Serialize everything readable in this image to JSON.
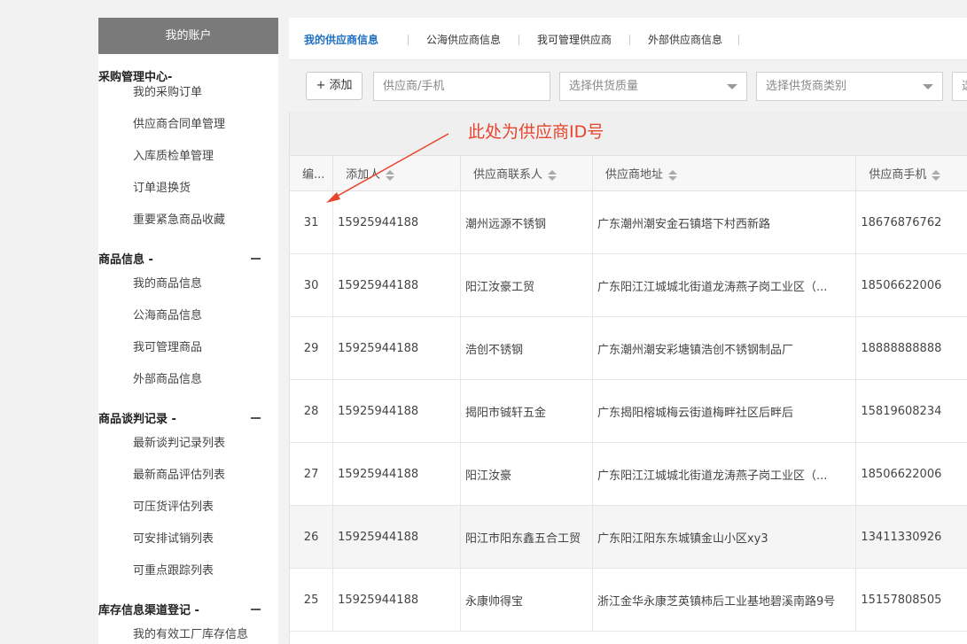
{
  "sidebar": {
    "account": "我的账户",
    "sections": [
      {
        "title": "采购管理中心-",
        "collapse": false,
        "items": [
          "我的采购订单",
          "供应商合同单管理",
          "入库质检单管理",
          "订单退换货",
          "重要紧急商品收藏"
        ]
      },
      {
        "title": "商品信息 -",
        "collapse": true,
        "items": [
          "我的商品信息",
          "公海商品信息",
          "我可管理商品",
          "外部商品信息"
        ]
      },
      {
        "title": "商品谈判记录 -",
        "collapse": true,
        "items": [
          "最新谈判记录列表",
          "最新商品评估列表",
          "可压货评估列表",
          "可安排试销列表",
          "可重点跟踪列表"
        ]
      },
      {
        "title": "库存信息渠道登记 -",
        "collapse": true,
        "items": [
          "我的有效工厂库存信息"
        ]
      }
    ]
  },
  "tabs": [
    "我的供应商信息",
    "公海供应商信息",
    "我可管理供应商",
    "外部供应商信息"
  ],
  "toolbar": {
    "add_label": "+ 添加",
    "search_placeholder": "供应商/手机",
    "quality_select": "选择供货质量",
    "category_select": "选择供货商类别",
    "extra_select": "选"
  },
  "annotation": "此处为供应商ID号",
  "table": {
    "headers": [
      "编...",
      "添加人",
      "供应商联系人",
      "供应商地址",
      "供应商手机"
    ],
    "rows": [
      [
        "31",
        "15925944188",
        "潮州远源不锈钢",
        "广东潮州潮安金石镇塔下村西新路",
        "18676876762"
      ],
      [
        "30",
        "15925944188",
        "阳江汝豪工贸",
        "广东阳江江城城北街道龙涛燕子岗工业区（...",
        "18506622006"
      ],
      [
        "29",
        "15925944188",
        "浩创不锈钢",
        "广东潮州潮安彩塘镇浩创不锈钢制品厂",
        "18888888888"
      ],
      [
        "28",
        "15925944188",
        "揭阳市铖轩五金",
        "广东揭阳榕城梅云街道梅畔社区后畔后",
        "15819608234"
      ],
      [
        "27",
        "15925944188",
        "阳江汝豪",
        "广东阳江江城城北街道龙涛燕子岗工业区（...",
        "18506622006"
      ],
      [
        "26",
        "15925944188",
        "阳江市阳东鑫五合工贸",
        "广东阳江阳东东城镇金山小区xy3",
        "13411330926"
      ],
      [
        "25",
        "15925944188",
        "永康帅得宝",
        "浙江金华永康芝英镇柿后工业基地碧溪南路9号",
        "15157808505"
      ]
    ]
  },
  "colors": {
    "accent": "#1e6fbf",
    "annotation": "#e8442e",
    "sidebar_header": "#7a7a7a"
  }
}
